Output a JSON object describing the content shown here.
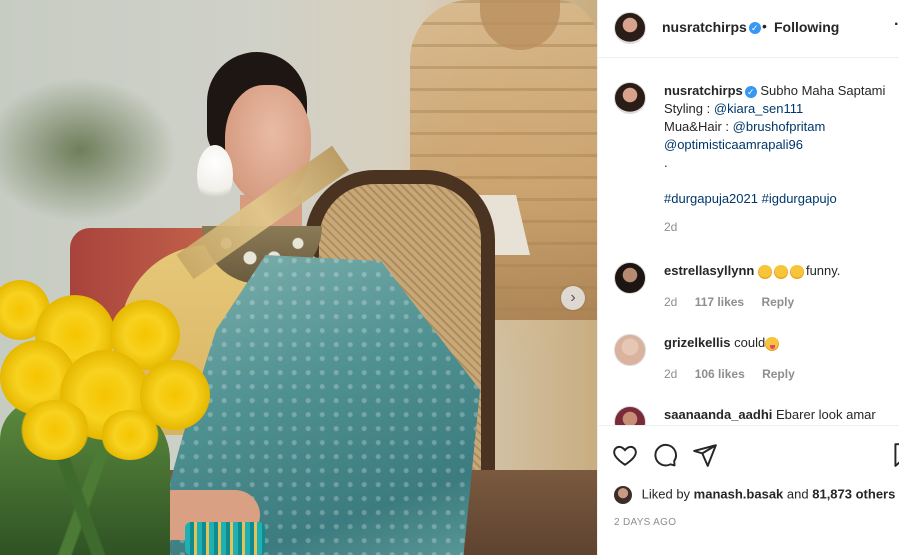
{
  "post": {
    "username": "nusratchirps",
    "verified_symbol": "✓",
    "dot": "•",
    "follow_status": "Following",
    "more": "·"
  },
  "caption": {
    "username": "nusratchirps",
    "line1": "Subho Maha Saptami",
    "styling_label": "Styling :",
    "styling_tag": "@kiara_sen111",
    "mua_label": "Mua&Hair :",
    "mua_tag": "@brushofpritam",
    "line4": "@optimisticaamrapali96",
    "line5": ".",
    "hashtag1": "#durgapuja2021",
    "hashtag2": "#igdurgapujo",
    "time": "2d"
  },
  "comments": [
    {
      "username": "estrellasyllynn",
      "text": "funny.",
      "time": "2d",
      "likes": "117 likes",
      "reply": "Reply"
    },
    {
      "username": "grizelkellis",
      "text": "could",
      "time": "2d",
      "likes": "106 likes",
      "reply": "Reply"
    },
    {
      "username": "saanaanda_aadhi",
      "text": "Ebarer look amar"
    }
  ],
  "liked_by": {
    "prefix": "Liked by",
    "user": "manash.basak",
    "middle": "and",
    "count": "81,873 others"
  },
  "post_time": "2 DAYS AGO",
  "carousel": {
    "next_symbol": "›"
  },
  "icons": [
    "heart-icon",
    "comment-icon",
    "share-icon",
    "bookmark-icon"
  ],
  "colors": {
    "verified": "#3897f0",
    "tag": "#00376b",
    "muted": "#8e8e8e"
  }
}
